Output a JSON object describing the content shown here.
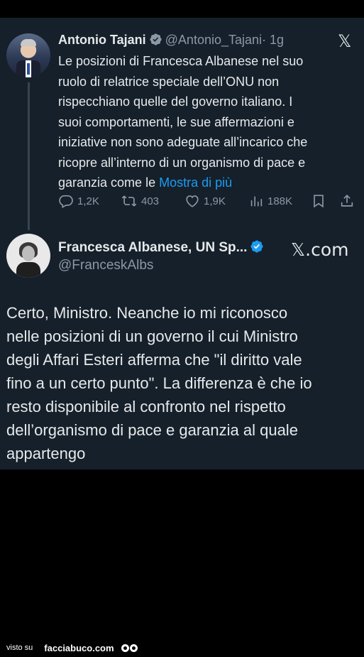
{
  "tweet": {
    "author_name": "Antonio Tajani",
    "author_handle": "@Antonio_Tajani",
    "time": "· 1g",
    "platform_icon": "x-logo-icon",
    "text_lines": [
      "Le posizioni di Francesca Albanese nel suo",
      "ruolo di relatrice speciale dell’ONU non",
      "rispecchiano quelle del governo italiano. I",
      "suoi comportamenti, le sue affermazioni e",
      "iniziative non sono adeguate all’incarico che",
      "ricopre all’interno di un organismo di pace e",
      "garanzia come le"
    ],
    "show_more": "Mostra di più",
    "replies": "1,2K",
    "retweets": "403",
    "likes": "1,9K",
    "views": "188K"
  },
  "reply": {
    "author_name": "Francesca Albanese, UN Sp...",
    "author_handle": "@FranceskAlbs",
    "platform_label": "𝕏.com",
    "text_lines": [
      "Certo, Ministro. Neanche io mi riconosco",
      "nelle posizioni di un governo il cui Ministro",
      "degli Affari Esteri afferma che \"il diritto vale",
      "fino a un certo punto\". La differenza è che io",
      "resto disponibile al confronto nel rispetto",
      "dell’organismo di pace e garanzia al quale",
      "appartengo"
    ]
  },
  "footer": {
    "prefix": "visto su",
    "site": "facciabuco.com"
  },
  "colors": {
    "card_bg": "#15202b",
    "accent": "#1d9bf0",
    "muted": "#8b98a5",
    "text": "#e7e9ea"
  }
}
